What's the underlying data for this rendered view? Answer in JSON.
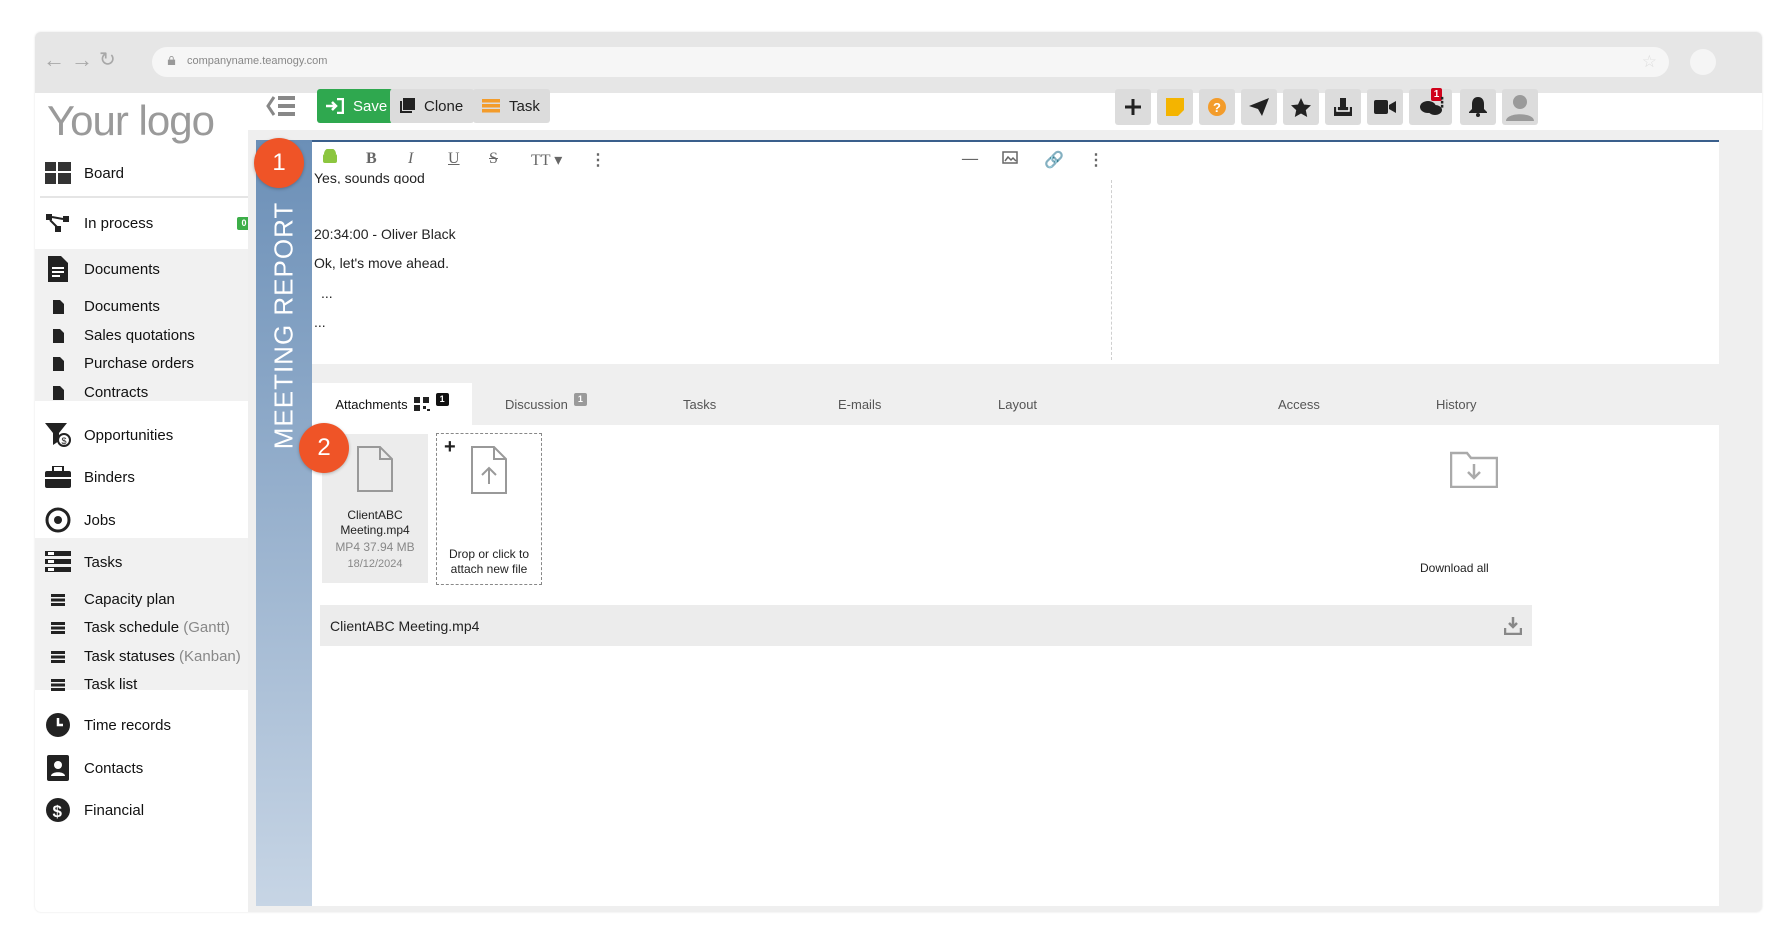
{
  "browser": {
    "url": "companyname.teamogy.com"
  },
  "logo": "Your logo",
  "sidebar": {
    "board": "Board",
    "in_process": "In process",
    "in_process_badge": "0",
    "documents": "Documents",
    "documents_items": [
      "Documents",
      "Sales quotations",
      "Purchase orders",
      "Contracts"
    ],
    "opportunities": "Opportunities",
    "binders": "Binders",
    "jobs": "Jobs",
    "tasks": "Tasks",
    "tasks_items": [
      {
        "label": "Capacity plan",
        "suffix": ""
      },
      {
        "label": "Task schedule",
        "suffix": "(Gantt)"
      },
      {
        "label": "Task statuses",
        "suffix": "(Kanban)"
      },
      {
        "label": "Task list",
        "suffix": ""
      }
    ],
    "time_records": "Time records",
    "contacts": "Contacts",
    "financial": "Financial"
  },
  "toolbar": {
    "save": "Save",
    "clone": "Clone",
    "task": "Task",
    "messages_badge": "1"
  },
  "colors": {
    "save_green": "#2fa84f",
    "callout_orange": "#ef5427",
    "header_blue": "#3a5f8c"
  },
  "record": {
    "vertical_title": "MEETING REPORT"
  },
  "editor": {
    "lines": [
      "Yes, sounds good",
      "20:34:00 - Oliver Black",
      "Ok, let's move ahead.",
      "...",
      "..."
    ]
  },
  "tabs": {
    "attachments": "Attachments",
    "attachments_badge": "1",
    "discussion": "Discussion",
    "discussion_badge": "1",
    "tasks": "Tasks",
    "emails": "E-mails",
    "layout": "Layout",
    "access": "Access",
    "history": "History"
  },
  "attachment": {
    "name": "ClientABC Meeting.mp4",
    "meta": "MP4 37.94 MB",
    "date": "18/12/2024"
  },
  "drop_zone": {
    "text": "Drop or click to attach new file"
  },
  "download_all": "Download all",
  "file_row": {
    "name": "ClientABC Meeting.mp4"
  },
  "callouts": [
    "1",
    "2"
  ]
}
